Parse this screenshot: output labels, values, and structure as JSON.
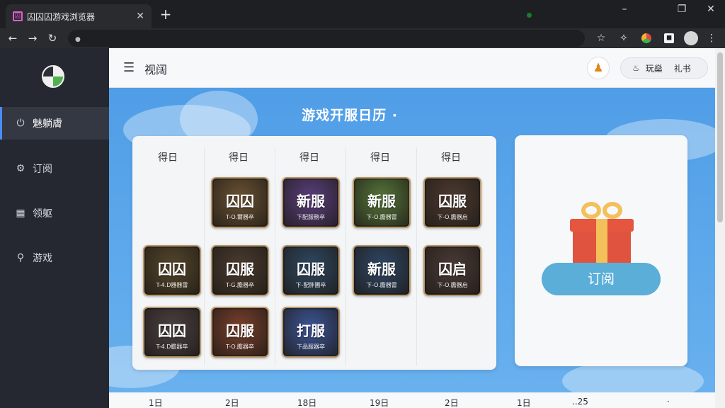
{
  "browser": {
    "tab_title": "囚囚囚游戏浏览器",
    "tab_favicon": "囚",
    "new_tab_symbol": "+",
    "window_controls": {
      "minimize": "–",
      "maximize": "❐",
      "close": "✕"
    },
    "nav": {
      "back": "←",
      "forward": "→",
      "reload": "↻"
    },
    "omnibox_icon": "●",
    "toolbar_icons": [
      "☆",
      "✧",
      "",
      "◼",
      "",
      "⋮"
    ]
  },
  "sidebar": {
    "items": [
      {
        "label": "魅躺膚",
        "icon": "⏻",
        "active": true
      },
      {
        "label": "订阅",
        "icon": "⚙",
        "active": false
      },
      {
        "label": "领躯",
        "icon": "▦",
        "active": false
      },
      {
        "label": "游戏",
        "icon": "⚲",
        "active": false
      }
    ]
  },
  "header": {
    "menu_icon": "☰",
    "title": "视阔",
    "avatar_icon": "♟",
    "gift_icon": "♨",
    "gift_label_1": "玩燊",
    "gift_label_2": "礼书"
  },
  "calendar": {
    "title": "游戏开服日历 ·",
    "columns": [
      "得日",
      "得日",
      "得日",
      "得日",
      "得日"
    ],
    "tiles": [
      {
        "col": 1,
        "row": 0,
        "title": "囚囚",
        "sub": "T-O.爾器卒",
        "color": "#6b5232"
      },
      {
        "col": 2,
        "row": 0,
        "title": "新服",
        "sub": "下配服務卒",
        "color": "#5a3f7d"
      },
      {
        "col": 3,
        "row": 0,
        "title": "新服",
        "sub": "下-O.膽器雷",
        "color": "#56763a"
      },
      {
        "col": 4,
        "row": 0,
        "title": "囚服",
        "sub": "下-O.膽器启",
        "color": "#4e3a30"
      },
      {
        "col": 0,
        "row": 1,
        "title": "囚囚",
        "sub": "T-4.D器器雷",
        "color": "#554629"
      },
      {
        "col": 1,
        "row": 1,
        "title": "囚服",
        "sub": "T-G.膽器卒",
        "color": "#4b3b2e"
      },
      {
        "col": 2,
        "row": 1,
        "title": "囚服",
        "sub": "下-配胖圕卒",
        "color": "#2f4862"
      },
      {
        "col": 3,
        "row": 1,
        "title": "新服",
        "sub": "下-O.膽器雷",
        "color": "#2f4664"
      },
      {
        "col": 4,
        "row": 1,
        "title": "囚启",
        "sub": "下-O.膽器启",
        "color": "#4a3a36"
      },
      {
        "col": 0,
        "row": 2,
        "title": "囚囚",
        "sub": "T-4.D膽器卒",
        "color": "#4a4040"
      },
      {
        "col": 1,
        "row": 2,
        "title": "囚服",
        "sub": "T-O.膽器卒",
        "color": "#7a3f2c"
      },
      {
        "col": 2,
        "row": 2,
        "title": "打服",
        "sub": "下品服器卒",
        "color": "#3c5597"
      }
    ]
  },
  "gift_card": {
    "button_label": "订阅"
  },
  "bottom_strip": {
    "labels": [
      "1日",
      "2日",
      "18日",
      "19日",
      "2日",
      "1日",
      "..25",
      "·"
    ]
  }
}
